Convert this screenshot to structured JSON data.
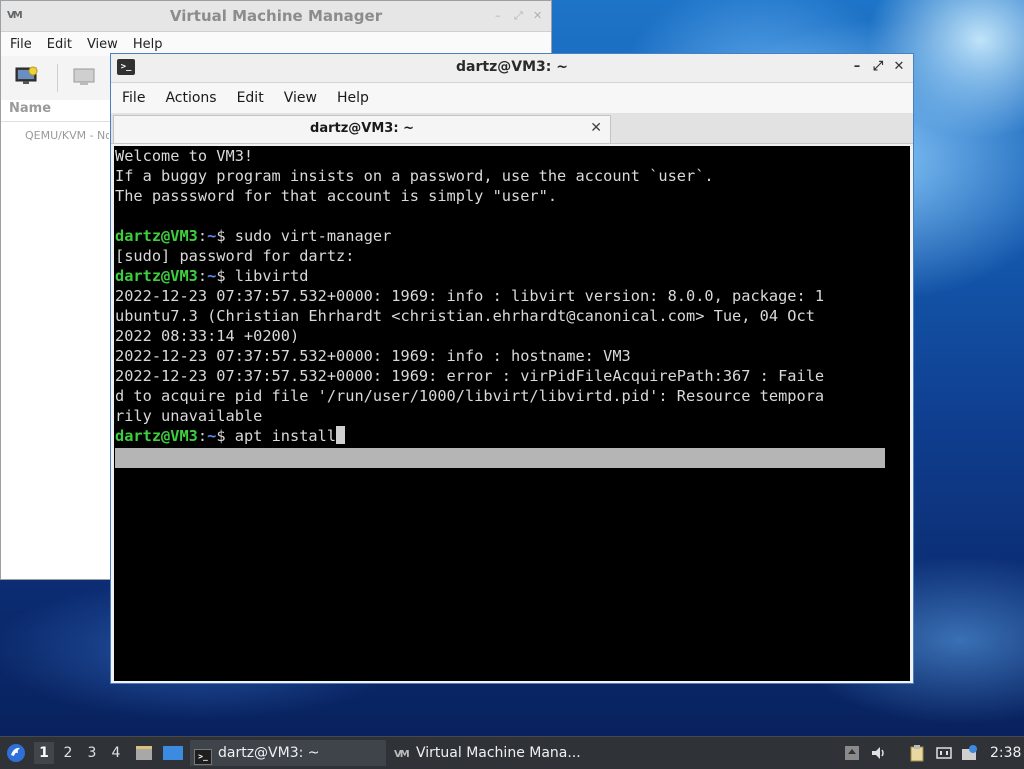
{
  "vmm": {
    "title": "Virtual Machine Manager",
    "menu": [
      "File",
      "Edit",
      "View",
      "Help"
    ],
    "column_name": "Name",
    "row_text": "QEMU/KVM - Not Connected"
  },
  "terminal": {
    "title": "dartz@VM3: ~",
    "menu": [
      "File",
      "Actions",
      "Edit",
      "View",
      "Help"
    ],
    "tab_label": "dartz@VM3: ~",
    "prompt_user": "dartz@VM3",
    "prompt_sep": ":",
    "prompt_path": "~",
    "prompt_sign": "$",
    "lines": {
      "l1": "Welcome to VM3!",
      "l2": "If a buggy program insists on a password, use the account `user`.",
      "l3": "The passsword for that account is simply \"user\".",
      "cmd1": " sudo virt-manager",
      "l5": "[sudo] password for dartz:",
      "cmd2": " libvirtd",
      "l7": "2022-12-23 07:37:57.532+0000: 1969: info : libvirt version: 8.0.0, package: 1",
      "l8": "ubuntu7.3 (Christian Ehrhardt <christian.ehrhardt@canonical.com> Tue, 04 Oct",
      "l9": "2022 08:33:14 +0200)",
      "l10": "2022-12-23 07:37:57.532+0000: 1969: info : hostname: VM3",
      "l11": "2022-12-23 07:37:57.532+0000: 1969: error : virPidFileAcquirePath:367 : Faile",
      "l12": "d to acquire pid file '/run/user/1000/libvirt/libvirtd.pid': Resource tempora",
      "l13": "rily unavailable",
      "cmd3": " apt install"
    }
  },
  "taskbar": {
    "workspaces": [
      "1",
      "2",
      "3",
      "4"
    ],
    "tasks": [
      "dartz@VM3: ~",
      "Virtual Machine Mana..."
    ],
    "clock": "2:38"
  }
}
